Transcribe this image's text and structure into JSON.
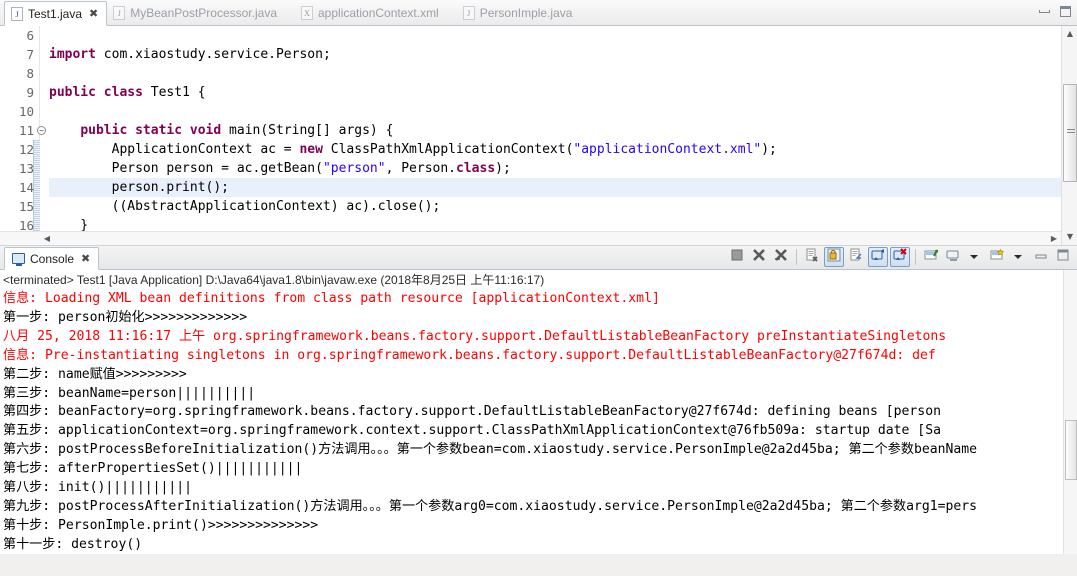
{
  "window": {
    "minimize_label": "minimize",
    "maximize_label": "maximize"
  },
  "editor": {
    "tabs": [
      {
        "label": "Test1.java",
        "icon": "java-file-icon",
        "active": true,
        "close": "✖"
      },
      {
        "label": "MyBeanPostProcessor.java",
        "icon": "java-file-icon",
        "active": false
      },
      {
        "label": "applicationContext.xml",
        "icon": "xml-file-icon",
        "active": false
      },
      {
        "label": "PersonImple.java",
        "icon": "java-file-icon",
        "active": false
      }
    ],
    "line_numbers": [
      "6",
      "7",
      "8",
      "9",
      "10",
      "11",
      "12",
      "13",
      "14",
      "15",
      "16"
    ],
    "code_lines": [
      {
        "n": "6",
        "segments": []
      },
      {
        "n": "7",
        "segments": [
          {
            "t": "import",
            "c": "kw"
          },
          {
            "t": " com.xiaostudy.service.Person;",
            "c": "pl"
          }
        ]
      },
      {
        "n": "8",
        "segments": []
      },
      {
        "n": "9",
        "segments": [
          {
            "t": "public",
            "c": "kw"
          },
          {
            "t": " ",
            "c": "pl"
          },
          {
            "t": "class",
            "c": "kw"
          },
          {
            "t": " Test1 {",
            "c": "pl"
          }
        ]
      },
      {
        "n": "10",
        "segments": []
      },
      {
        "n": "11",
        "segments": [
          {
            "t": "    ",
            "c": "pl"
          },
          {
            "t": "public",
            "c": "kw"
          },
          {
            "t": " ",
            "c": "pl"
          },
          {
            "t": "static",
            "c": "kw"
          },
          {
            "t": " ",
            "c": "pl"
          },
          {
            "t": "void",
            "c": "kw"
          },
          {
            "t": " main(String[] args) {",
            "c": "pl"
          }
        ]
      },
      {
        "n": "12",
        "segments": [
          {
            "t": "        ApplicationContext ac = ",
            "c": "pl"
          },
          {
            "t": "new",
            "c": "kw"
          },
          {
            "t": " ClassPathXmlApplicationContext(",
            "c": "pl"
          },
          {
            "t": "\"applicationContext.xml\"",
            "c": "str"
          },
          {
            "t": ");",
            "c": "pl"
          }
        ]
      },
      {
        "n": "13",
        "segments": [
          {
            "t": "        Person person = ac.getBean(",
            "c": "pl"
          },
          {
            "t": "\"person\"",
            "c": "str"
          },
          {
            "t": ", Person.",
            "c": "pl"
          },
          {
            "t": "class",
            "c": "kw"
          },
          {
            "t": ");",
            "c": "pl"
          }
        ]
      },
      {
        "n": "14",
        "highlight": true,
        "segments": [
          {
            "t": "        person.print();",
            "c": "pl"
          }
        ]
      },
      {
        "n": "15",
        "segments": [
          {
            "t": "        ((AbstractApplicationContext) ac).close();",
            "c": "pl"
          }
        ]
      },
      {
        "n": "16",
        "segments": [
          {
            "t": "    }",
            "c": "pl"
          }
        ]
      }
    ]
  },
  "console": {
    "tab_label": "Console",
    "tab_close": "✖",
    "tab_icon": "console-monitor-icon",
    "toolbar": [
      {
        "name": "terminate-button",
        "icon": "stop-square-icon"
      },
      {
        "name": "remove-launch-button",
        "icon": "remove-x-icon"
      },
      {
        "name": "remove-all-terminated-button",
        "icon": "remove-all-xx-icon"
      },
      {
        "name": "separator-1",
        "icon": "separator"
      },
      {
        "name": "clear-console-button",
        "icon": "clear-console-icon"
      },
      {
        "name": "scroll-lock-button",
        "icon": "scroll-lock-icon",
        "pressed": true
      },
      {
        "name": "word-wrap-button",
        "icon": "word-wrap-icon"
      },
      {
        "name": "show-console-on-output-button",
        "icon": "show-console-output-icon",
        "pressed": true
      },
      {
        "name": "show-console-on-error-button",
        "icon": "show-console-error-icon",
        "pressed": true
      },
      {
        "name": "separator-2",
        "icon": "separator"
      },
      {
        "name": "pin-console-button",
        "icon": "pin-console-icon"
      },
      {
        "name": "display-selected-console-button",
        "icon": "display-console-icon"
      },
      {
        "name": "display-console-menu-button",
        "icon": "chevron-down-icon"
      },
      {
        "name": "open-console-button",
        "icon": "open-console-icon"
      },
      {
        "name": "open-console-menu-button",
        "icon": "chevron-down-icon"
      },
      {
        "name": "minimize-view-button",
        "icon": "minimize-icon"
      },
      {
        "name": "maximize-view-button",
        "icon": "maximize-icon"
      }
    ],
    "terminated_line": "<terminated> Test1 [Java Application] D:\\Java64\\java1.8\\bin\\javaw.exe (2018年8月25日 上午11:16:17)",
    "output_lines": [
      {
        "color": "red",
        "text": "信息: Loading XML bean definitions from class path resource [applicationContext.xml]"
      },
      {
        "color": "black",
        "text": "第一步: person初始化>>>>>>>>>>>>>"
      },
      {
        "color": "red",
        "text": "八月 25, 2018 11:16:17 上午 org.springframework.beans.factory.support.DefaultListableBeanFactory preInstantiateSingletons"
      },
      {
        "color": "red",
        "text": "信息: Pre-instantiating singletons in org.springframework.beans.factory.support.DefaultListableBeanFactory@27f674d: def"
      },
      {
        "color": "black",
        "text": "第二步: name赋值>>>>>>>>>"
      },
      {
        "color": "black",
        "text": "第三步: beanName=person||||||||||"
      },
      {
        "color": "black",
        "text": "第四步: beanFactory=org.springframework.beans.factory.support.DefaultListableBeanFactory@27f674d: defining beans [person"
      },
      {
        "color": "black",
        "text": "第五步: applicationContext=org.springframework.context.support.ClassPathXmlApplicationContext@76fb509a: startup date [Sa"
      },
      {
        "color": "black",
        "text": "第六步: postProcessBeforeInitialization()方法调用。。。第一个参数bean=com.xiaostudy.service.PersonImple@2a2d45ba; 第二个参数beanName"
      },
      {
        "color": "black",
        "text": "第七步: afterPropertiesSet()|||||||||||"
      },
      {
        "color": "black",
        "text": "第八步: init()|||||||||||"
      },
      {
        "color": "black",
        "text": "第九步: postProcessAfterInitialization()方法调用。。。第一个参数arg0=com.xiaostudy.service.PersonImple@2a2d45ba; 第二个参数arg1=pers"
      },
      {
        "color": "black",
        "text": "第十步: PersonImple.print()>>>>>>>>>>>>>>"
      },
      {
        "color": "black",
        "text": "第十一步: destroy()"
      }
    ]
  },
  "colors": {
    "keyword": "#7f0055",
    "string": "#2a00ff",
    "error_red": "#ff0000",
    "highlight_line": "#e8f1fb"
  }
}
